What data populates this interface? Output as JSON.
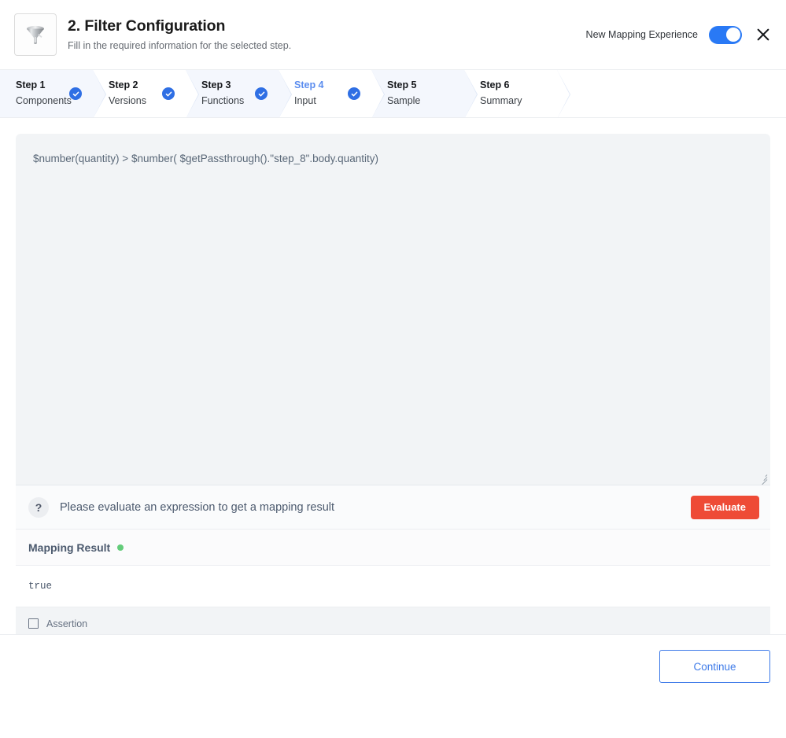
{
  "header": {
    "icon": "funnel-icon",
    "title": "2. Filter Configuration",
    "subtitle": "Fill in the required information for the selected step.",
    "toggle_label": "New Mapping Experience",
    "toggle_on": true,
    "close_icon": "close-icon",
    "toggle_accent": "#2979f5"
  },
  "stepper": {
    "active_index": 3,
    "steps": [
      {
        "num": "Step 1",
        "name": "Components",
        "completed": true
      },
      {
        "num": "Step 2",
        "name": "Versions",
        "completed": true
      },
      {
        "num": "Step 3",
        "name": "Functions",
        "completed": true
      },
      {
        "num": "Step 4",
        "name": "Input",
        "completed": true
      },
      {
        "num": "Step 5",
        "name": "Sample",
        "completed": false
      },
      {
        "num": "Step 6",
        "name": "Summary",
        "completed": false
      }
    ]
  },
  "editor": {
    "expression": "$number(quantity) > $number( $getPassthrough().\"step_8\".body.quantity)",
    "resize_handle": "resize-grip-icon"
  },
  "evaluate": {
    "help_icon": "question-mark-icon",
    "message": "Please evaluate an expression to get a mapping result",
    "button_label": "Evaluate",
    "button_color": "#ee4b36"
  },
  "result": {
    "title": "Mapping Result",
    "status_color": "#63cc7a",
    "value": "true"
  },
  "assertion": {
    "label": "Assertion",
    "checked": false
  },
  "footer": {
    "continue_label": "Continue",
    "accent": "#3d7ae8"
  }
}
